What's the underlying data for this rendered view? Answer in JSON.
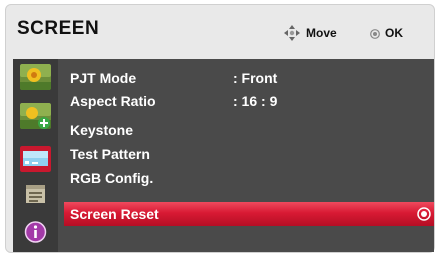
{
  "header": {
    "title": "SCREEN",
    "hint_move_icon": "four-way-arrow-icon",
    "hint_move": "Move",
    "hint_ok_icon": "ok-button-icon",
    "hint_ok": "OK"
  },
  "sidebar": {
    "icons": [
      {
        "name": "picture-icon"
      },
      {
        "name": "picture-add-icon"
      },
      {
        "name": "screen-icon"
      },
      {
        "name": "options-icon"
      },
      {
        "name": "info-icon"
      }
    ]
  },
  "menu": {
    "items": [
      {
        "label": "PJT Mode",
        "value": ": Front"
      },
      {
        "label": "Aspect Ratio",
        "value": ": 16 : 9"
      },
      {
        "label": "Keystone",
        "value": ""
      },
      {
        "label": "Test Pattern",
        "value": ""
      },
      {
        "label": "RGB Config.",
        "value": ""
      },
      {
        "label": "Screen Reset",
        "value": "",
        "selected": true
      }
    ]
  },
  "colors": {
    "selected_row": "#d81a34",
    "panel_bg": "#4a4a4a",
    "frame_bg": "#e9e9e9"
  }
}
